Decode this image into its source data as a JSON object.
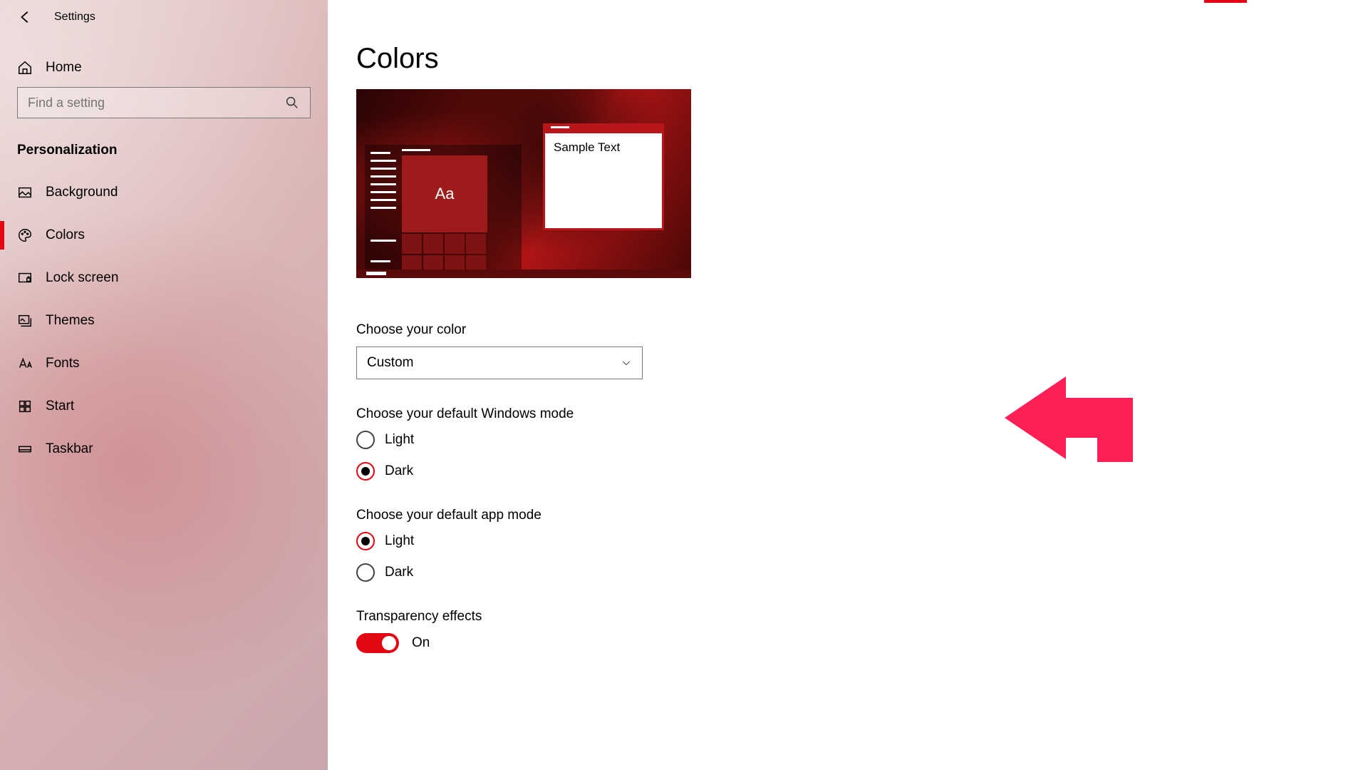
{
  "window": {
    "title": "Settings"
  },
  "sidebar": {
    "home": "Home",
    "search_placeholder": "Find a setting",
    "section": "Personalization",
    "items": [
      {
        "label": "Background",
        "icon": "image-icon"
      },
      {
        "label": "Colors",
        "icon": "palette-icon",
        "active": true
      },
      {
        "label": "Lock screen",
        "icon": "lock-screen-icon"
      },
      {
        "label": "Themes",
        "icon": "themes-icon"
      },
      {
        "label": "Fonts",
        "icon": "fonts-icon"
      },
      {
        "label": "Start",
        "icon": "start-icon"
      },
      {
        "label": "Taskbar",
        "icon": "taskbar-icon"
      }
    ]
  },
  "page": {
    "title": "Colors",
    "preview": {
      "sample_text": "Sample Text",
      "tile_label": "Aa"
    },
    "choose_color": {
      "label": "Choose your color",
      "value": "Custom"
    },
    "windows_mode": {
      "label": "Choose your default Windows mode",
      "options": [
        {
          "label": "Light",
          "selected": false
        },
        {
          "label": "Dark",
          "selected": true
        }
      ]
    },
    "app_mode": {
      "label": "Choose your default app mode",
      "options": [
        {
          "label": "Light",
          "selected": true
        },
        {
          "label": "Dark",
          "selected": false
        }
      ]
    },
    "transparency": {
      "label": "Transparency effects",
      "state": "On",
      "on": true
    }
  },
  "colors": {
    "accent": "#e30613",
    "annotation": "#ff1f57"
  }
}
